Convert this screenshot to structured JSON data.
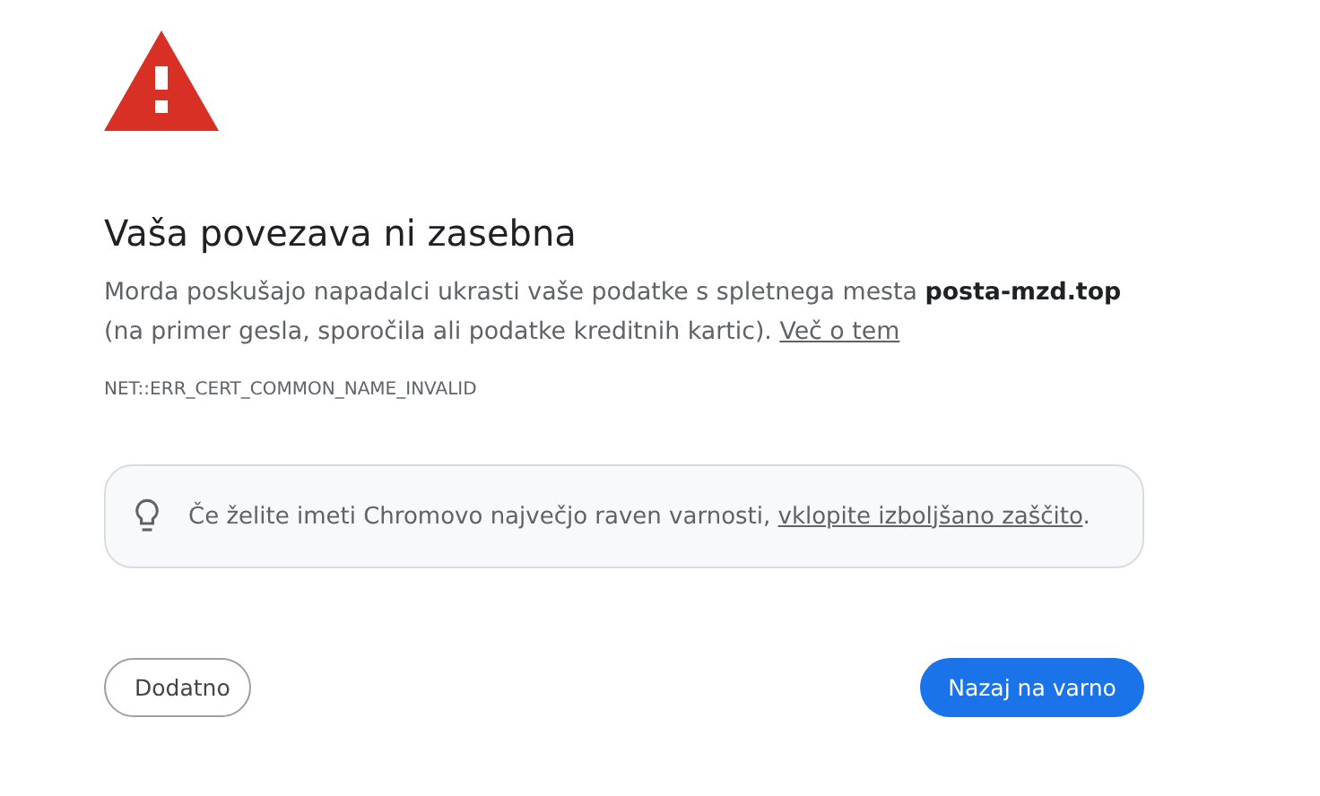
{
  "heading": "Vaša povezava ni zasebna",
  "message": {
    "text": "Morda poskušajo napadalci ukrasti vaše podatke s spletnega mesta **posta-mzd.top** (na primer gesla, sporočila ali podatke kreditnih kartic).",
    "link": "Več o tem"
  },
  "error_code": "NET::ERR_CERT_COMMON_NAME_INVALID",
  "tip": {
    "text": "Če želite imeti Chromovo največjo raven varnosti,",
    "link": "vklopite izboljšano zaščito",
    "end": "."
  },
  "buttons": [
    {
      "label": "Dodatno",
      "kind": "secondary"
    },
    {
      "label": "Nazaj na varno",
      "kind": "primary"
    }
  ]
}
